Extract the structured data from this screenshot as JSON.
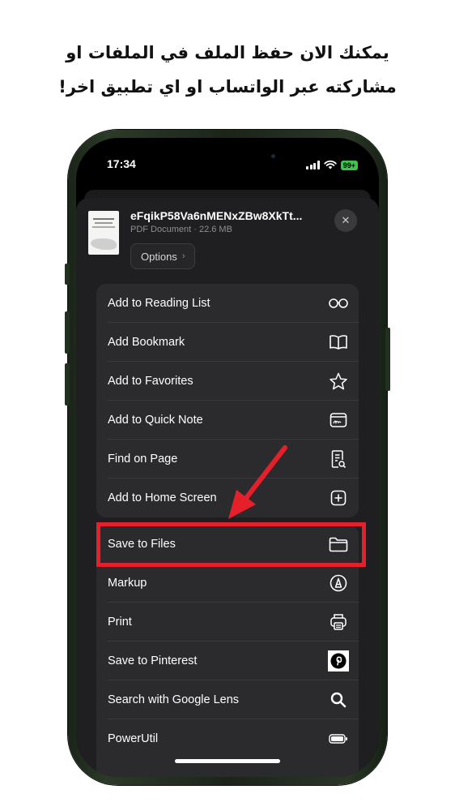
{
  "caption": {
    "line1": "يمكنك الان حفظ الملف في الملفات  او",
    "line2": "مشاركته عبر الواتساب او اي تطبيق اخر!"
  },
  "status_bar": {
    "time": "17:34",
    "battery": "99+",
    "icons": [
      "signal-icon",
      "wifi-icon",
      "battery-icon"
    ]
  },
  "share_header": {
    "file_name": "eFqikP58Va6nMENxZBw8XkTt...",
    "file_meta": "PDF Document · 22.6 MB",
    "options_label": "Options",
    "options_chevron": "›",
    "close_glyph": "✕"
  },
  "actions_group_1": [
    {
      "label": "Add to Reading List",
      "icon": "glasses-icon"
    },
    {
      "label": "Add Bookmark",
      "icon": "book-icon"
    },
    {
      "label": "Add to Favorites",
      "icon": "star-icon"
    },
    {
      "label": "Add to Quick Note",
      "icon": "quick-note-icon"
    },
    {
      "label": "Find on Page",
      "icon": "find-document-icon"
    },
    {
      "label": "Add to Home Screen",
      "icon": "plus-square-icon"
    }
  ],
  "actions_group_2": [
    {
      "label": "Save to Files",
      "icon": "folder-icon",
      "highlighted": true
    },
    {
      "label": "Markup",
      "icon": "markup-pen-icon"
    },
    {
      "label": "Print",
      "icon": "printer-icon"
    },
    {
      "label": "Save to Pinterest",
      "icon": "pinterest-icon"
    },
    {
      "label": "Search with Google Lens",
      "icon": "search-icon"
    },
    {
      "label": "PowerUtil",
      "icon": "battery-bar-icon"
    }
  ],
  "colors": {
    "annotation_red": "#e5202a",
    "sheet_background": "#1f1f21",
    "row_background": "#2b2b2e",
    "phone_frame": "#1f2b1c",
    "battery_green": "#3ac748"
  }
}
